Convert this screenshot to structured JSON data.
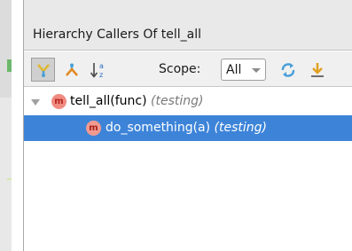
{
  "panel": {
    "title": "Hierarchy Callers Of tell_all"
  },
  "toolbar": {
    "buttons": [
      {
        "name": "caller-hierarchy",
        "icon": "caller-hierarchy-icon",
        "pressed": true
      },
      {
        "name": "callee-hierarchy",
        "icon": "callee-hierarchy-icon",
        "pressed": false
      },
      {
        "name": "sort-alphabetically",
        "icon": "sort-alphabetically-icon",
        "pressed": false
      }
    ],
    "scope_label": "Scope:",
    "scope_value": "All",
    "refresh_icon": "refresh-icon",
    "export_icon": "export-icon"
  },
  "tree": {
    "rows": [
      {
        "badge": "m",
        "name": "tell_all(func)",
        "context": "(testing)",
        "expanded": true,
        "selected": false
      },
      {
        "badge": "m",
        "name": "do_something(a)",
        "context": "(testing)",
        "expanded": false,
        "selected": true
      }
    ]
  },
  "colors": {
    "selection": "#3d84d9",
    "method_badge": "#f08b82",
    "scope_refresh": "#4a9fd8",
    "export_arrow": "#e0a020"
  }
}
